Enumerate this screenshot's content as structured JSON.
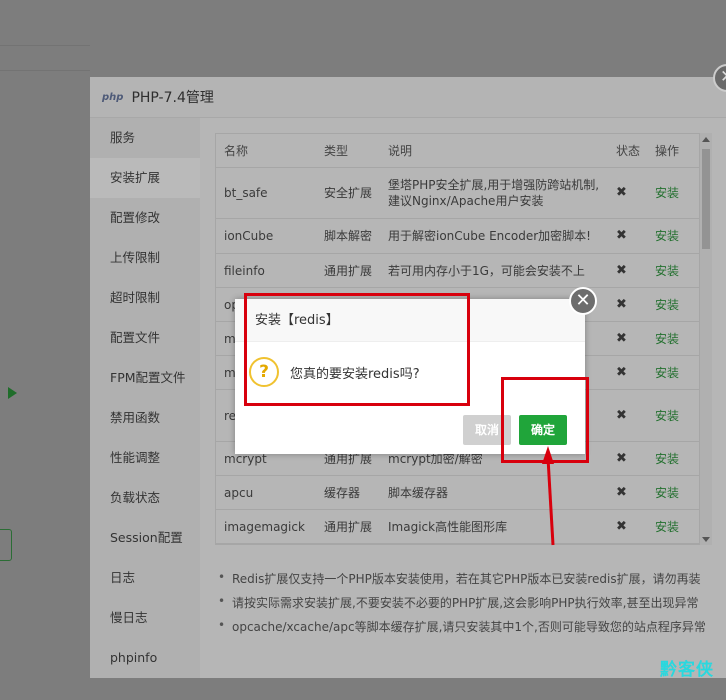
{
  "modal": {
    "logo": "php",
    "title": "PHP-7.4管理"
  },
  "sidebar": {
    "items": [
      {
        "label": "服务"
      },
      {
        "label": "安装扩展",
        "active": true
      },
      {
        "label": "配置修改"
      },
      {
        "label": "上传限制"
      },
      {
        "label": "超时限制"
      },
      {
        "label": "配置文件"
      },
      {
        "label": "FPM配置文件"
      },
      {
        "label": "禁用函数"
      },
      {
        "label": "性能调整"
      },
      {
        "label": "负载状态"
      },
      {
        "label": "Session配置"
      },
      {
        "label": "日志"
      },
      {
        "label": "慢日志"
      },
      {
        "label": "phpinfo"
      }
    ]
  },
  "table": {
    "headers": {
      "name": "名称",
      "type": "类型",
      "desc": "说明",
      "status": "状态",
      "action": "操作"
    },
    "rows": [
      {
        "name": "bt_safe",
        "type": "安全扩展",
        "desc": "堡塔PHP安全扩展,用于增强防跨站机制,建议Nginx/Apache用户安装",
        "status": "✖",
        "action": "安装"
      },
      {
        "name": "ionCube",
        "type": "脚本解密",
        "desc": "用于解密ionCube Encoder加密脚本!",
        "status": "✖",
        "action": "安装"
      },
      {
        "name": "fileinfo",
        "type": "通用扩展",
        "desc": "若可用内存小于1G，可能会安装不上",
        "status": "✖",
        "action": "安装"
      },
      {
        "name": "op",
        "type": "",
        "desc": "",
        "status": "✖",
        "action": "安装"
      },
      {
        "name": "m",
        "type": "",
        "desc": "",
        "status": "✖",
        "action": "安装"
      },
      {
        "name": "m",
        "type": "",
        "desc": "",
        "status": "✖",
        "action": "安装"
      },
      {
        "name": "re",
        "type": "",
        "desc": "",
        "status": "✖",
        "action": "安装"
      },
      {
        "name": "mcrypt",
        "type": "通用扩展",
        "desc": "mcrypt加密/解密",
        "status": "✖",
        "action": "安装"
      },
      {
        "name": "apcu",
        "type": "缓存器",
        "desc": "脚本缓存器",
        "status": "✖",
        "action": "安装"
      },
      {
        "name": "imagemagick",
        "type": "通用扩展",
        "desc": "Imagick高性能图形库",
        "status": "✖",
        "action": "安装"
      }
    ]
  },
  "notes": [
    "Redis扩展仅支持一个PHP版本安装使用，若在其它PHP版本已安装redis扩展，请勿再装",
    "请按实际需求安装扩展,不要安装不必要的PHP扩展,这会影响PHP执行效率,甚至出现异常",
    "opcache/xcache/apc等脚本缓存扩展,请只安装其中1个,否则可能导致您的站点程序异常"
  ],
  "dialog": {
    "title": "安装【redis】",
    "icon": "?",
    "message": "您真的要安装redis吗?",
    "cancel": "取消",
    "confirm": "确定",
    "close": "✕"
  },
  "outer_close": "✕",
  "watermark": "黔客侠",
  "colors": {
    "confirm": "#20a53a",
    "install_link": "#23702f",
    "annotation": "#d8000d"
  }
}
